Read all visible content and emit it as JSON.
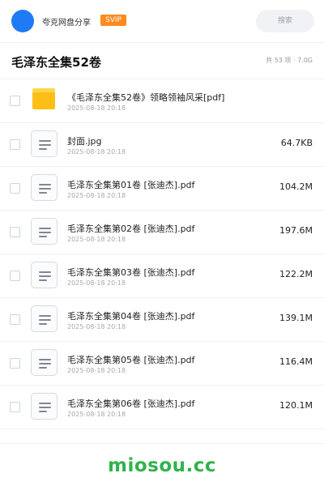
{
  "header": {
    "share_title": "夸克网盘分享",
    "vip_badge": "SVIP",
    "search_label": "搜索"
  },
  "folder": {
    "title": "毛泽东全集52卷",
    "meta": "共 53 项 · 7.0G"
  },
  "files": [
    {
      "name": "《毛泽东全集52卷》领略领袖风采[pdf]",
      "date": "2025-08-18 20:18",
      "size": "",
      "icon": "folder-icon"
    },
    {
      "name": "封面.jpg",
      "date": "2025-08-18 20:18",
      "size": "64.7KB",
      "icon": "document-icon"
    },
    {
      "name": "毛泽东全集第01卷 [张迪杰].pdf",
      "date": "2025-08-18 20:18",
      "size": "104.2M",
      "icon": "document-icon"
    },
    {
      "name": "毛泽东全集第02卷 [张迪杰].pdf",
      "date": "2025-08-18 20:18",
      "size": "197.6M",
      "icon": "document-icon"
    },
    {
      "name": "毛泽东全集第03卷 [张迪杰].pdf",
      "date": "2025-08-18 20:18",
      "size": "122.2M",
      "icon": "document-icon"
    },
    {
      "name": "毛泽东全集第04卷 [张迪杰].pdf",
      "date": "2025-08-18 20:18",
      "size": "139.1M",
      "icon": "document-icon"
    },
    {
      "name": "毛泽东全集第05卷 [张迪杰].pdf",
      "date": "2025-08-18 20:18",
      "size": "116.4M",
      "icon": "document-icon"
    },
    {
      "name": "毛泽东全集第06卷 [张迪杰].pdf",
      "date": "2025-08-18 20:18",
      "size": "120.1M",
      "icon": "document-icon"
    }
  ],
  "watermark": "miosou.cc",
  "colors": {
    "avatar": "#1e7bf5",
    "vip_badge": "#ff8a1f",
    "folder": "#fcbf16",
    "watermark": "#2fb34c"
  }
}
